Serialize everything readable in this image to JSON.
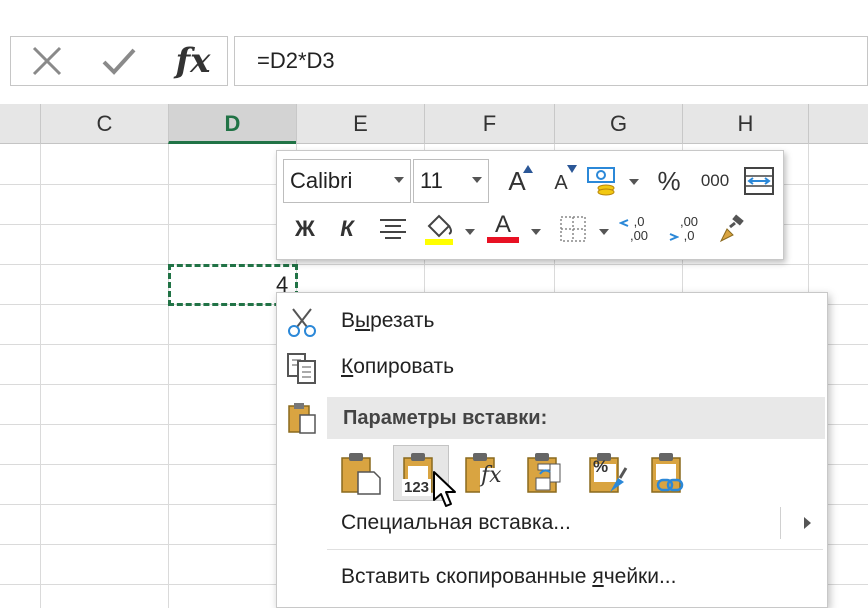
{
  "formula_bar": {
    "cancel_icon": "x-icon",
    "enter_icon": "check-icon",
    "fx_label": "fx",
    "formula": "=D2*D3"
  },
  "columns": [
    "C",
    "D",
    "E",
    "F",
    "G",
    "H"
  ],
  "active_column": "D",
  "cell": {
    "value": "4"
  },
  "mini_toolbar": {
    "font_name": "Calibri",
    "font_size": "11",
    "grow_font": "A",
    "shrink_font": "A",
    "percent": "%",
    "thousands": "000",
    "bold": "Ж",
    "italic": "К",
    "font_color_letter": "A",
    "decimal_inc_top": ",0",
    "decimal_inc_bottom": ",00",
    "decimal_dec_top": ",00",
    "decimal_dec_bottom": ",0",
    "colors": {
      "highlight": "#ffff00",
      "font": "#e81123"
    }
  },
  "context_menu": {
    "cut": {
      "pre": "В",
      "underline": "ы",
      "post": "резать"
    },
    "copy": {
      "pre": "",
      "underline": "К",
      "post": "опировать"
    },
    "paste_options_title": "Параметры вставки:",
    "paste_values_badge": "123",
    "paste_formula_badge": "fx",
    "paste_formatting_badge": "%",
    "special_paste": "Специальная вставка...",
    "insert_copied": {
      "pre": "Вставить скопированные ",
      "underline": "я",
      "post": "чейки..."
    }
  }
}
